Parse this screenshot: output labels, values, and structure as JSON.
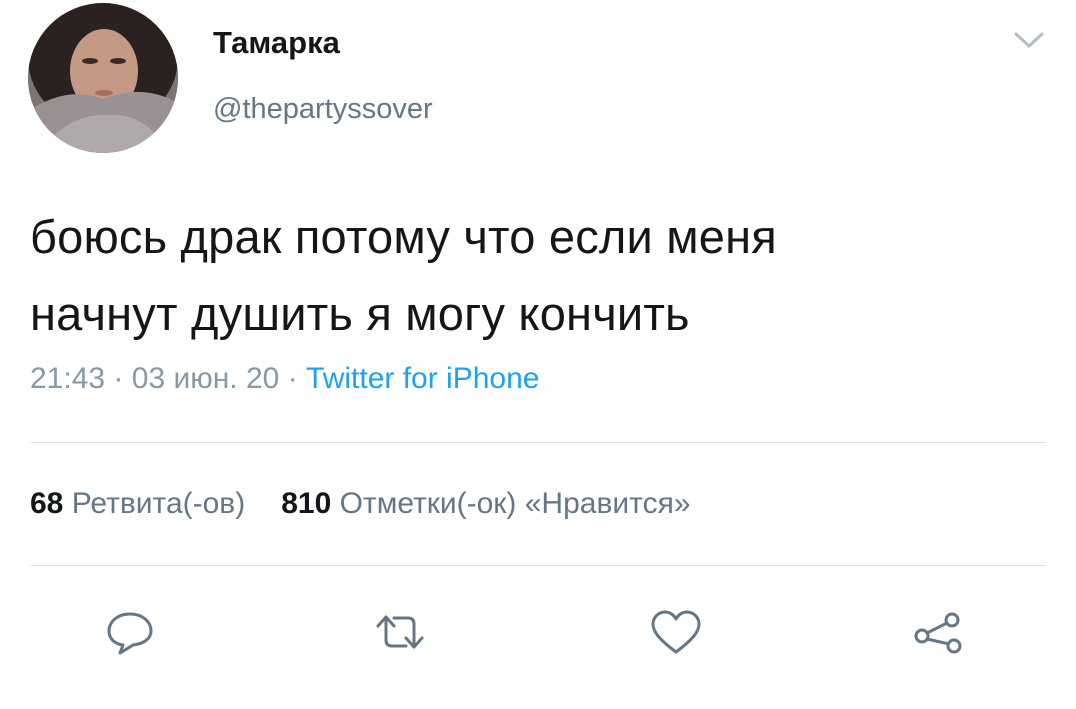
{
  "user": {
    "display_name": "Тамарка",
    "handle": "@thepartyssover"
  },
  "tweet": {
    "text_line1": "боюсь драк потому что если меня",
    "text_line2": "начнут душить я могу кончить",
    "time": "21:43",
    "separator": "·",
    "date": "03 июн. 20",
    "source": "Twitter for iPhone"
  },
  "stats": {
    "retweets_count": "68",
    "retweets_label": "Ретвита(-ов)",
    "likes_count": "810",
    "likes_label": "Отметки(-ок) «Нравится»"
  },
  "icons": {
    "menu": "chevron-down-icon",
    "reply": "reply-bubble-icon",
    "retweet": "retweet-icon",
    "like": "heart-icon",
    "share": "share-icon"
  },
  "colors": {
    "text": "#14171a",
    "secondary": "#657786",
    "link": "#1da1f2",
    "icon": "#657786",
    "divider": "#dfe3e6"
  }
}
